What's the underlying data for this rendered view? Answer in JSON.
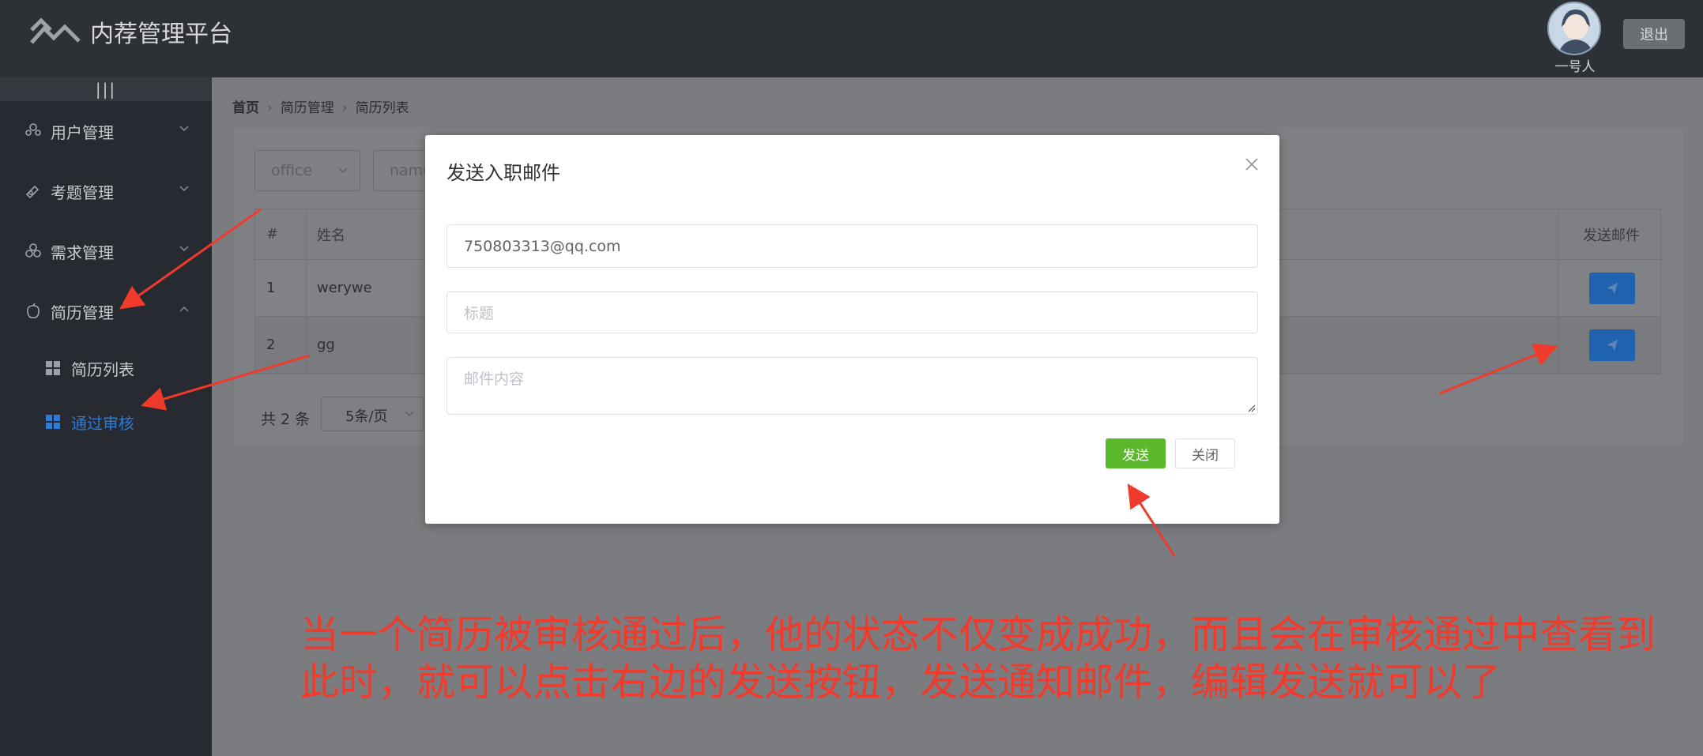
{
  "header": {
    "title": "内荐管理平台",
    "user_name": "一号人",
    "logout_label": "退出"
  },
  "sidebar": {
    "collapse_label": "|||",
    "items": [
      {
        "label": "用户管理",
        "icon": "user-group-icon"
      },
      {
        "label": "考题管理",
        "icon": "exam-icon"
      },
      {
        "label": "需求管理",
        "icon": "demand-icon"
      },
      {
        "label": "简历管理",
        "icon": "resume-icon"
      }
    ],
    "sub_items": [
      {
        "label": "简历列表",
        "active": false
      },
      {
        "label": "通过审核",
        "active": true
      }
    ]
  },
  "breadcrumb": [
    "首页",
    "简历管理",
    "简历列表"
  ],
  "filters": {
    "office_placeholder": "office",
    "name_placeholder": "name"
  },
  "table": {
    "headers": {
      "index": "#",
      "name": "姓名",
      "send_mail": "发送邮件"
    },
    "rows": [
      {
        "index": "1",
        "name": "werywe"
      },
      {
        "index": "2",
        "name": "gg"
      }
    ]
  },
  "pagination": {
    "total": "共 2 条",
    "page_size": "5条/页"
  },
  "modal": {
    "title": "发送入职邮件",
    "email_value": "750803313@qq.com",
    "subject_placeholder": "标题",
    "content_placeholder": "邮件内容",
    "send_label": "发送",
    "close_label": "关闭"
  },
  "annotation": {
    "line1": "当一个简历被审核通过后，他的状态不仅变成成功，而且会在审核通过中查看到",
    "line2": "此时，就可以点击右边的发送按钮，发送通知邮件，编辑发送就可以了",
    "color": "#f03a2b"
  },
  "colors": {
    "header_bg": "#2d3035",
    "sidebar_bg": "#272a30",
    "active_blue": "#2d7bd6",
    "send_green": "#5cb82b"
  }
}
